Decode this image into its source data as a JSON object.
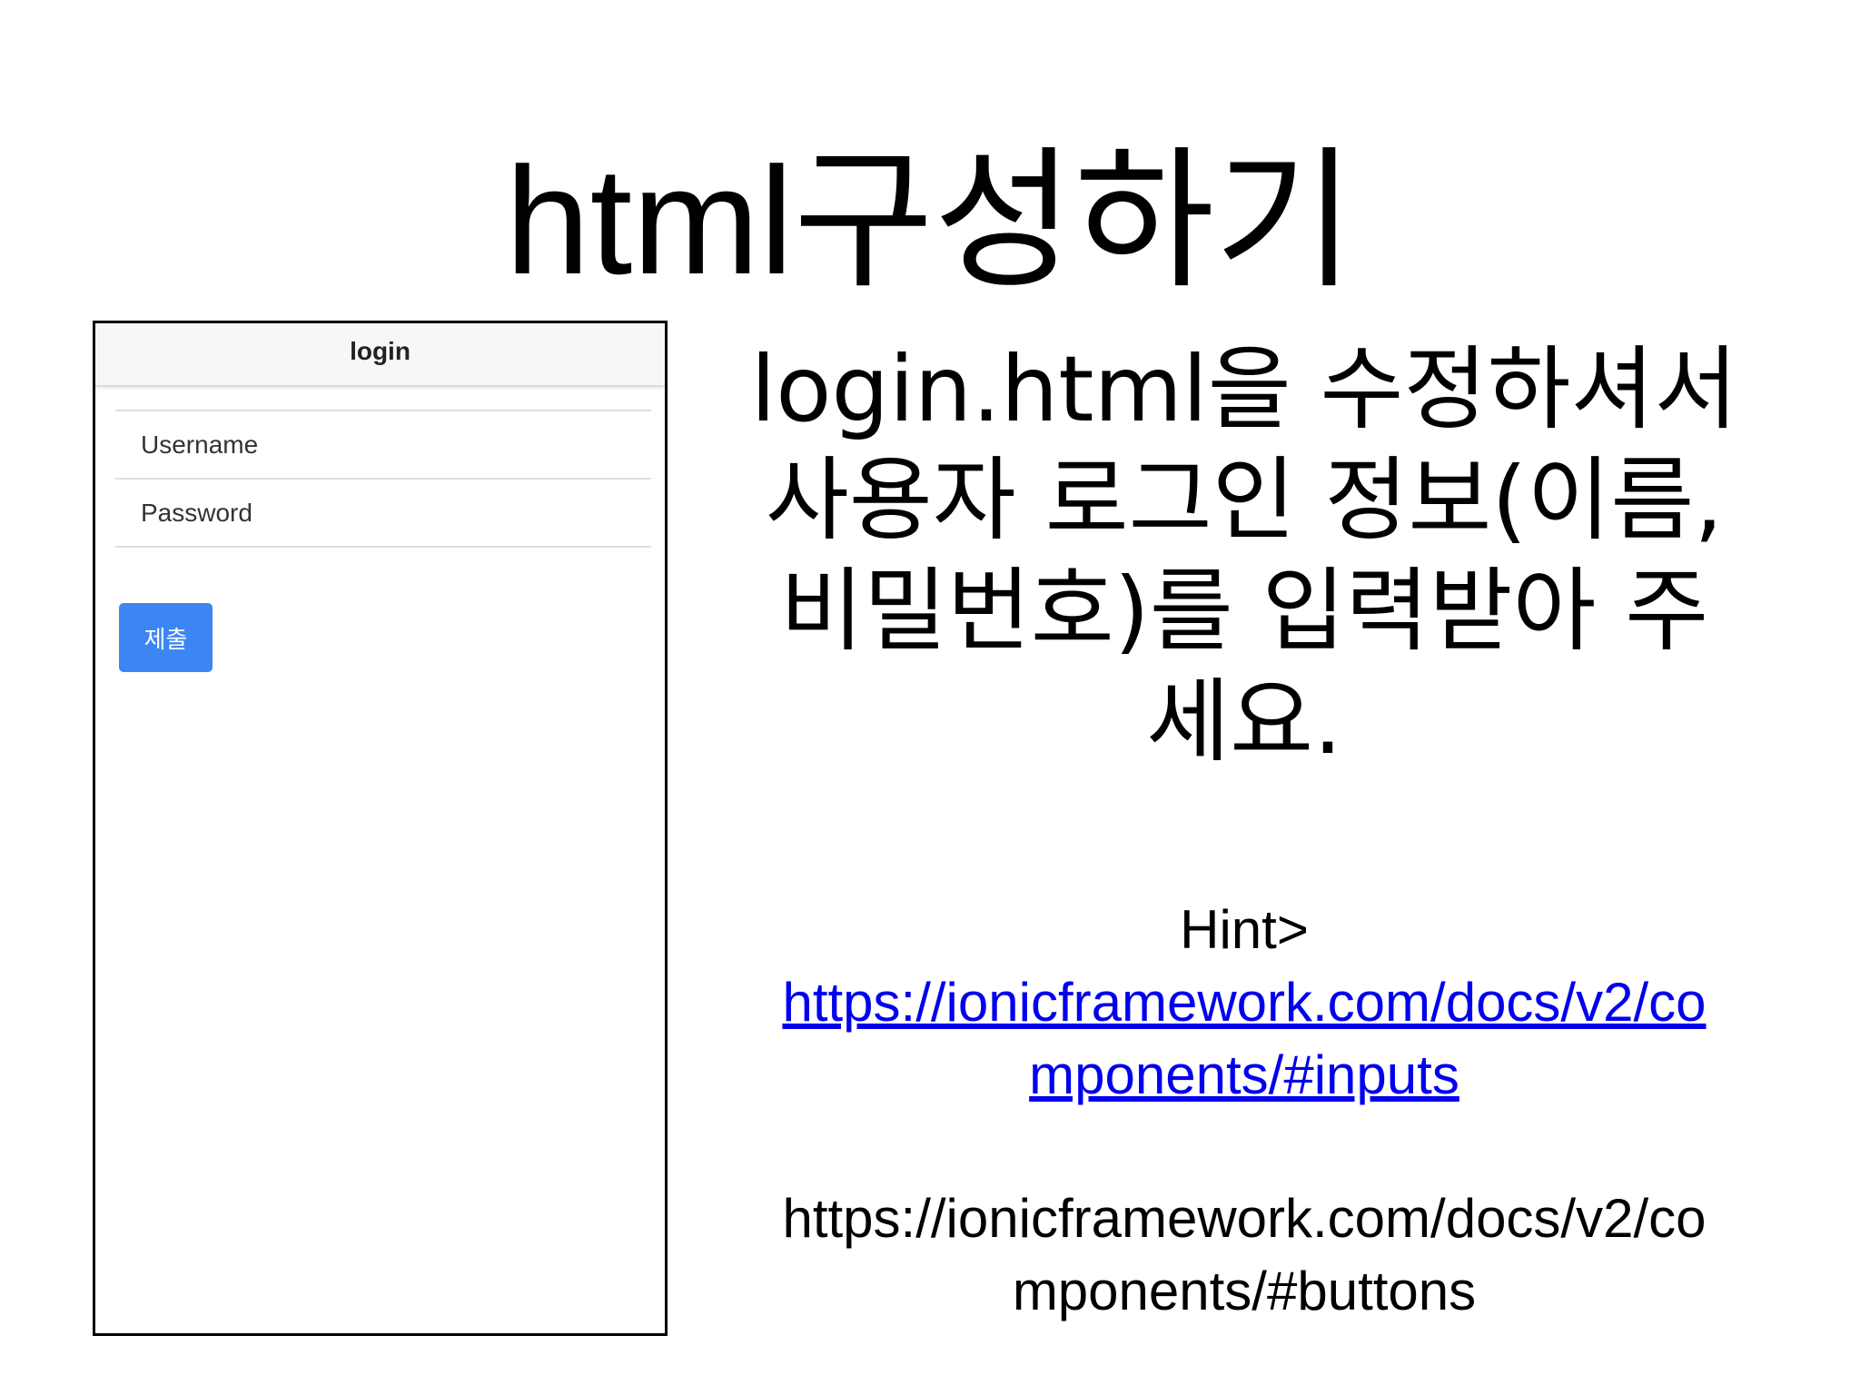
{
  "slide": {
    "title": "html구성하기"
  },
  "phone": {
    "header_title": "login",
    "username_placeholder": "Username",
    "password_placeholder": "Password",
    "submit_label": "제출",
    "submit_color": "#3c86f3"
  },
  "instruction": {
    "lines": [
      "login.html을 수정하셔서",
      "사용자 로그인 정보(이름,",
      "비밀번호)를 입력받아 주",
      "세요."
    ]
  },
  "hint": {
    "label": "Hint>",
    "link_lines": [
      "https://ionicframework.com/docs/v2/co",
      "mponents/#inputs"
    ],
    "link_color": "#0000ee"
  },
  "second_url": {
    "lines": [
      "https://ionicframework.com/docs/v2/co",
      "mponents/#buttons"
    ]
  }
}
